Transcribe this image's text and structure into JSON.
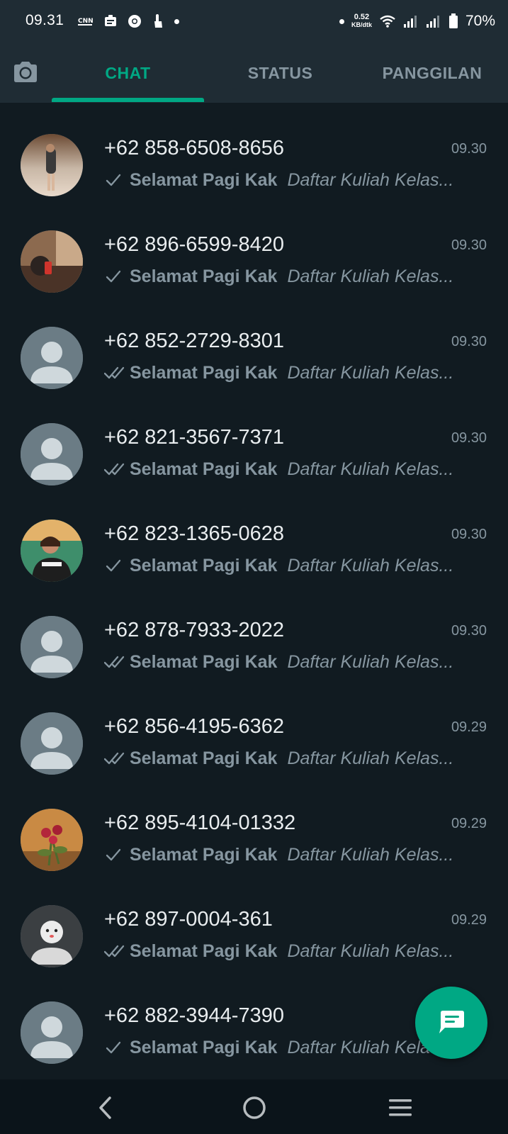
{
  "status_bar": {
    "time": "09.31",
    "network_speed_value": "0.52",
    "network_speed_unit": "KB/dtk",
    "battery_percent": "70%",
    "icons": [
      "cnn-indonesia-icon",
      "news-app-icon",
      "chrome-icon",
      "touch-icon",
      "notification-dot-icon"
    ]
  },
  "tabs": [
    {
      "label": "CHAT",
      "active": true
    },
    {
      "label": "STATUS",
      "active": false
    },
    {
      "label": "PANGGILAN",
      "active": false
    }
  ],
  "chats": [
    {
      "name": "+62 858-6508-8656",
      "time": "09.30",
      "tick": "single",
      "bold": "Selamat Pagi Kak",
      "italic": "Daftar Kuliah Kelas...",
      "avatar": "photo-1"
    },
    {
      "name": "+62 896-6599-8420",
      "time": "09.30",
      "tick": "single",
      "bold": "Selamat Pagi Kak",
      "italic": "Daftar Kuliah Kelas...",
      "avatar": "photo-2"
    },
    {
      "name": "+62 852-2729-8301",
      "time": "09.30",
      "tick": "double",
      "bold": "Selamat Pagi Kak",
      "italic": "Daftar Kuliah Kelas...",
      "avatar": "default"
    },
    {
      "name": "+62 821-3567-7371",
      "time": "09.30",
      "tick": "double",
      "bold": "Selamat Pagi Kak",
      "italic": "Daftar Kuliah Kelas...",
      "avatar": "default"
    },
    {
      "name": "+62 823-1365-0628",
      "time": "09.30",
      "tick": "single",
      "bold": "Selamat Pagi Kak",
      "italic": "Daftar Kuliah Kelas...",
      "avatar": "photo-3"
    },
    {
      "name": "+62 878-7933-2022",
      "time": "09.30",
      "tick": "double",
      "bold": "Selamat Pagi Kak",
      "italic": "Daftar Kuliah Kelas...",
      "avatar": "default"
    },
    {
      "name": "+62 856-4195-6362",
      "time": "09.29",
      "tick": "double",
      "bold": "Selamat Pagi Kak",
      "italic": "Daftar Kuliah Kelas...",
      "avatar": "default"
    },
    {
      "name": "+62 895-4104-01332",
      "time": "09.29",
      "tick": "single",
      "bold": "Selamat Pagi Kak",
      "italic": "Daftar Kuliah Kelas...",
      "avatar": "photo-4"
    },
    {
      "name": "+62 897-0004-361",
      "time": "09.29",
      "tick": "double",
      "bold": "Selamat Pagi Kak",
      "italic": "Daftar Kuliah Kelas...",
      "avatar": "cartoon"
    },
    {
      "name": "+62 882-3944-7390",
      "time": "",
      "tick": "single",
      "bold": "Selamat Pagi Kak",
      "italic": "Daftar Kuliah Kelas...",
      "avatar": "default"
    }
  ],
  "fab": {
    "icon": "new-chat-icon"
  },
  "nav_bar": {
    "icons": [
      "back-icon",
      "home-icon",
      "menu-icon"
    ]
  },
  "colors": {
    "accent": "#00a884",
    "background": "#111b21",
    "header": "#1f2c34",
    "secondary_text": "#8696a0",
    "primary_text": "#e9edef"
  }
}
